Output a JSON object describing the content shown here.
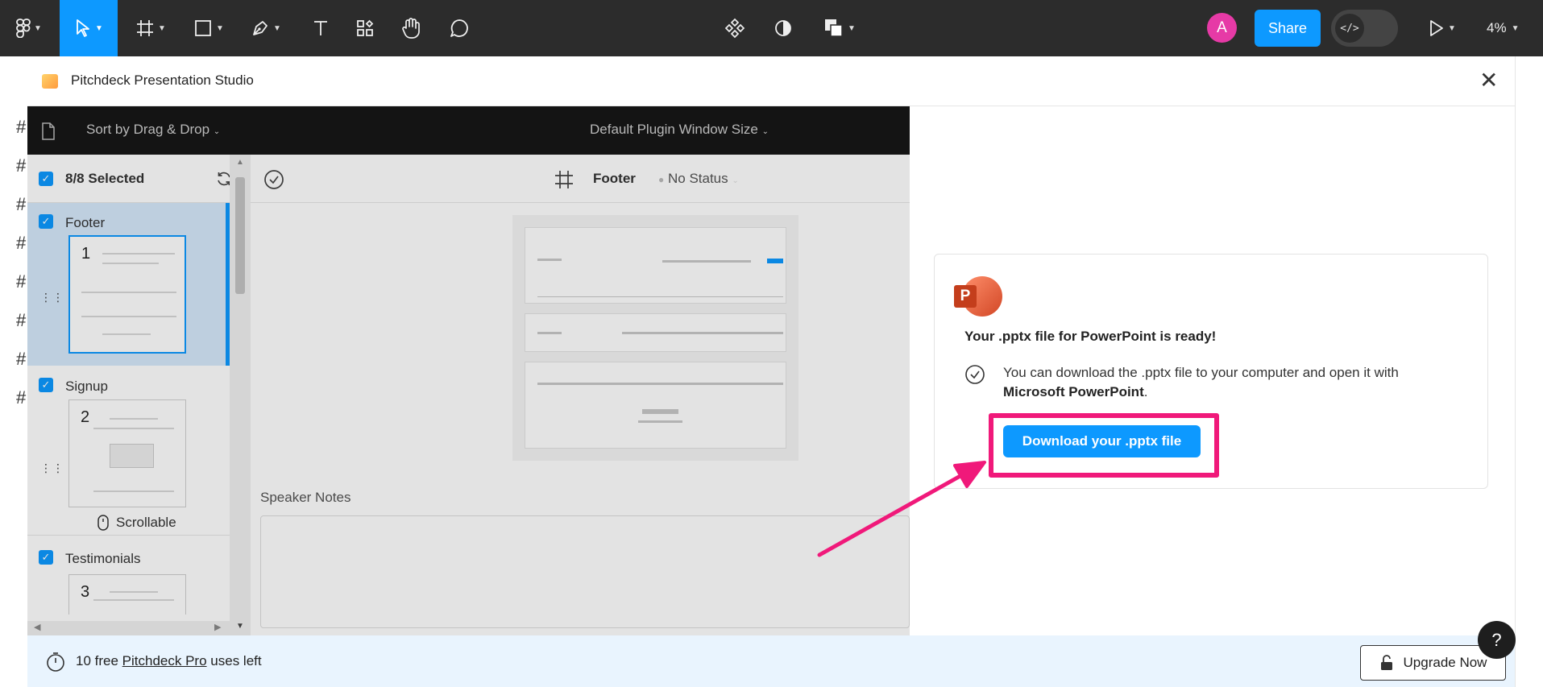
{
  "toolbar": {
    "avatar_initial": "A",
    "share_label": "Share",
    "zoom_level": "4%"
  },
  "plugin": {
    "title": "Pitchdeck Presentation Studio",
    "sort_label": "Sort by Drag & Drop",
    "window_size_label": "Default Plugin Window Size",
    "selected_count": "8/8 Selected",
    "slides": [
      {
        "name": "Footer",
        "number": "1"
      },
      {
        "name": "Signup",
        "number": "2"
      },
      {
        "name": "Testimonials",
        "number": "3"
      }
    ],
    "scrollable_label": "Scrollable",
    "frame_name": "Footer",
    "status_label": "No Status",
    "speaker_notes_label": "Speaker Notes"
  },
  "export": {
    "ready_title": "Your .pptx file for PowerPoint is ready!",
    "desc_prefix": "You can download the .pptx file to your computer and open it with",
    "desc_app": "Microsoft PowerPoint",
    "desc_suffix": ".",
    "download_label": "Download your .pptx file",
    "ppt_letter": "P"
  },
  "footer": {
    "uses_count": "10 free",
    "uses_link": "Pitchdeck Pro",
    "uses_suffix": "uses left",
    "upgrade_label": "Upgrade Now"
  },
  "help_label": "?",
  "colors": {
    "accent": "#0d99ff",
    "highlight": "#f0197a",
    "toolbar_bg": "#2c2c2c"
  }
}
